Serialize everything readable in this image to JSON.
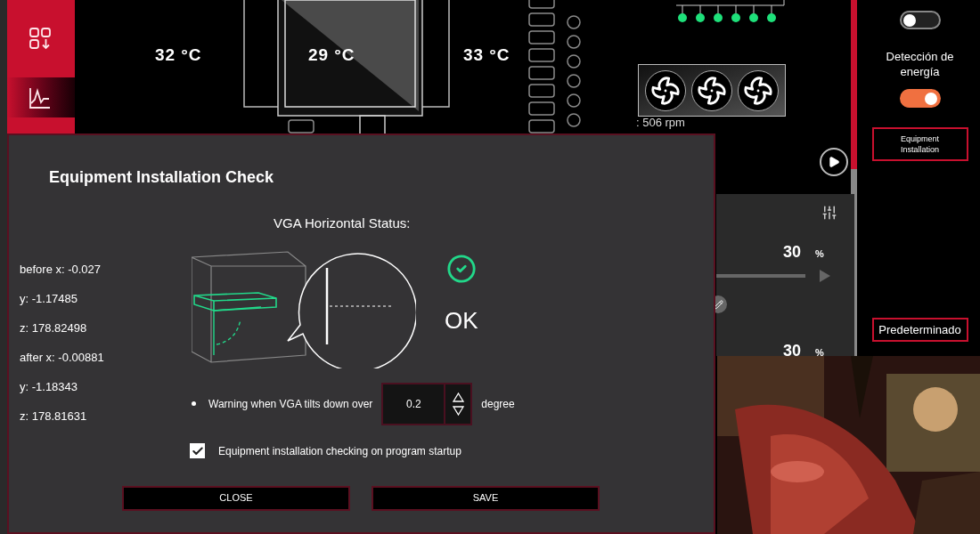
{
  "sidebar": {
    "items": [
      {
        "selected": false
      },
      {
        "selected": true
      }
    ]
  },
  "board": {
    "temperatures": [
      "32 °C",
      "29 °C",
      "33 °C"
    ],
    "fan_speed": ": 506 rpm"
  },
  "fan_panel": {
    "readings": [
      {
        "value": "30",
        "unit": "%"
      },
      {
        "value": "30",
        "unit": "%"
      }
    ]
  },
  "right_panel": {
    "top_toggle": {
      "on": false
    },
    "energy_detection": {
      "label": "Detección de energía",
      "on": true
    },
    "buttons": [
      "Equipment Installation",
      "Predeterminado"
    ]
  },
  "dialog": {
    "title": "Equipment Installation Check",
    "coordinates": [
      "before x: -0.027",
      "y: -1.17485",
      "z: 178.82498",
      "after x: -0.00881",
      "y: -1.18343",
      "z: 178.81631"
    ],
    "status_label": "VGA Horizontal Status:",
    "status": "OK",
    "warning": {
      "label": "Warning when VGA tilts down over",
      "value": "0.2",
      "unit": "degree"
    },
    "startup_check": {
      "label": "Equipment installation checking on program startup",
      "checked": true
    },
    "buttons": [
      "CLOSE",
      "SAVE"
    ]
  }
}
